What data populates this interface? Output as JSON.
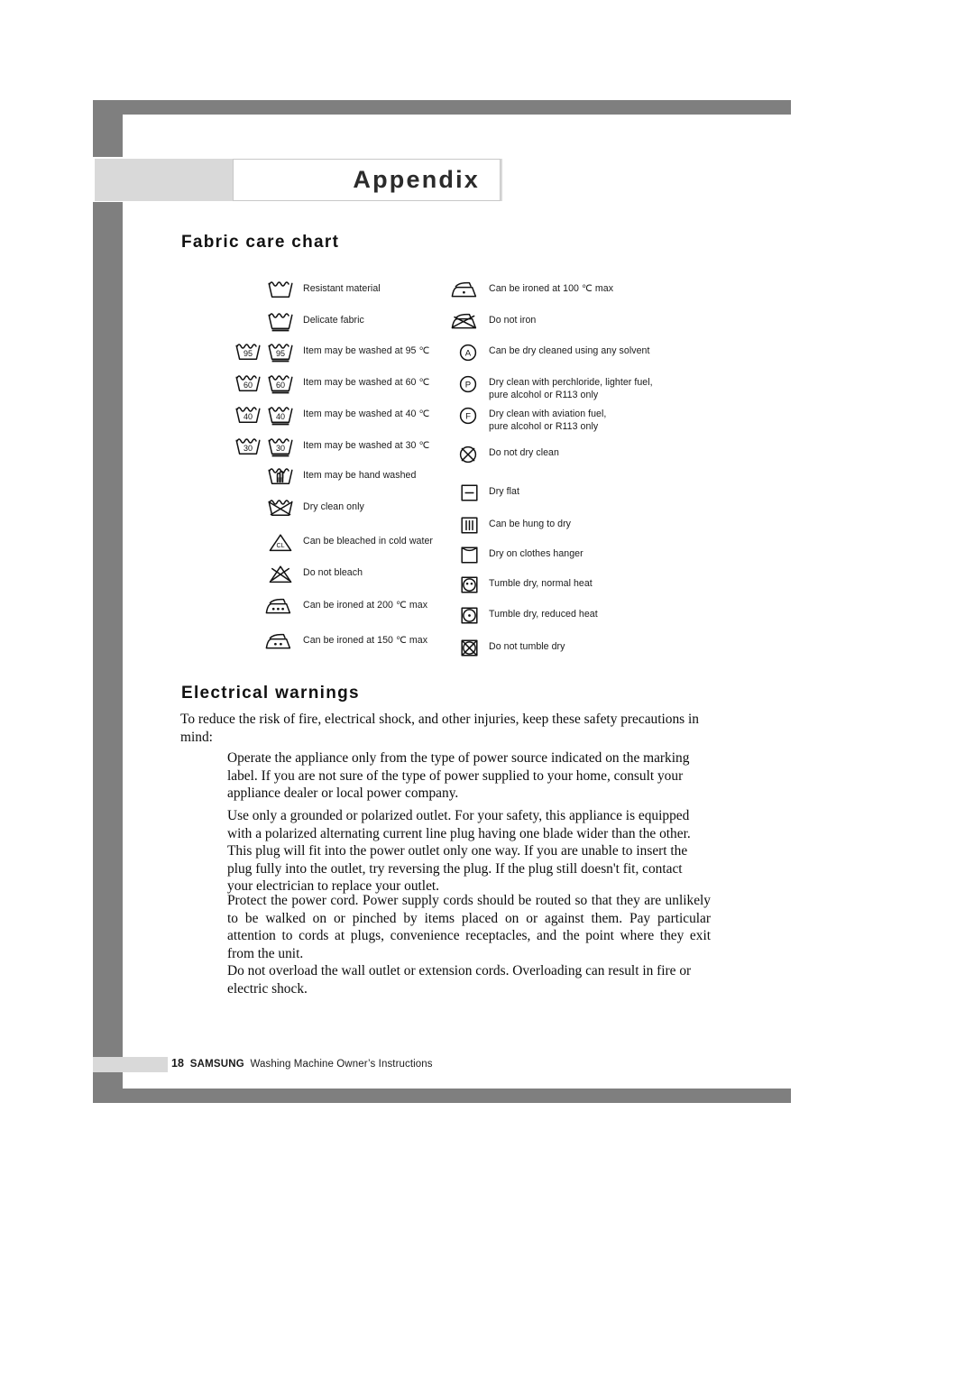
{
  "document": {
    "title": "Appendix"
  },
  "sections": {
    "fabric_care": {
      "heading": "Fabric care chart",
      "left_column": [
        {
          "icon": "wash-tub-resistant-icon",
          "label": "Resistant material"
        },
        {
          "icon": "wash-tub-delicate-icon",
          "label": "Delicate fabric"
        },
        {
          "icon": "wash-tub-95-icon",
          "label": "Item may be washed at 95 ℃"
        },
        {
          "icon": "wash-tub-60-icon",
          "label": "Item may be washed at 60 ℃"
        },
        {
          "icon": "wash-tub-40-icon",
          "label": "Item may be washed at 40 ℃"
        },
        {
          "icon": "wash-tub-30-icon",
          "label": "Item may be washed at 30 ℃"
        },
        {
          "icon": "hand-wash-icon",
          "label": "Item may be hand washed"
        },
        {
          "icon": "dry-clean-only-icon",
          "label": "Dry clean only"
        },
        {
          "icon": "bleach-cold-water-icon",
          "label": "Can be bleached in cold water"
        },
        {
          "icon": "do-not-bleach-icon",
          "label": "Do not bleach"
        },
        {
          "icon": "iron-200-icon",
          "label": "Can be ironed at 200 ℃ max"
        },
        {
          "icon": "iron-150-icon",
          "label": "Can be ironed at 150 ℃ max"
        }
      ],
      "right_column": [
        {
          "icon": "iron-100-icon",
          "label": "Can be ironed at 100 ℃  max"
        },
        {
          "icon": "do-not-iron-icon",
          "label": "Do not iron"
        },
        {
          "icon": "dry-clean-any-solvent-icon",
          "label": "Can be dry cleaned using any solvent"
        },
        {
          "icon": "dry-clean-perchloride-icon",
          "label": "Dry clean with perchloride, lighter fuel,\npure alcohol or R113 only"
        },
        {
          "icon": "dry-clean-aviation-fuel-icon",
          "label": "Dry clean with aviation fuel,\npure alcohol or R113 only"
        },
        {
          "icon": "do-not-dry-clean-icon",
          "label": "Do not dry clean"
        },
        {
          "icon": "dry-flat-icon",
          "label": "Dry flat"
        },
        {
          "icon": "hang-to-dry-icon",
          "label": "Can be hung to dry"
        },
        {
          "icon": "dry-on-hanger-icon",
          "label": "Dry on clothes hanger"
        },
        {
          "icon": "tumble-dry-normal-icon",
          "label": " Tumble dry, normal heat"
        },
        {
          "icon": "tumble-dry-reduced-icon",
          "label": "Tumble dry, reduced heat"
        },
        {
          "icon": "do-not-tumble-dry-icon",
          "label": "Do not tumble dry"
        }
      ]
    },
    "electrical_warnings": {
      "heading": "Electrical warnings",
      "intro": "To reduce the risk of fire, electrical shock, and other injuries, keep these safety precautions in mind:",
      "paragraphs": [
        "Operate the appliance only from the type of power source indicated on the marking label.  If you are not sure of the type of power supplied to your home, consult your appliance dealer or local power company.",
        "Use only a grounded or polarized outlet.  For your safety, this appliance is equipped with a polarized alternating current line plug having one blade wider than the other.  This plug will fit into the power outlet only one way.  If you are unable to insert the plug fully into the outlet, try reversing the plug.  If the plug still doesn't fit, contact your electrician to replace your outlet.",
        "Protect the power cord. Power supply cords should be routed so that they are unlikely to be walked on or pinched by items placed on or against them.  Pay particular attention to cords at plugs, convenience receptacles, and the point where they exit from the unit.",
        "Do not overload the wall outlet or extension cords.  Overloading can result in fire or electric shock."
      ]
    }
  },
  "footer": {
    "page_number": "18",
    "brand": "SAMSUNG",
    "manual_title": "Washing Machine Owner’s Instructions"
  },
  "colors": {
    "frame_gray": "#7f7f7f",
    "band_gray": "#d9d9d9",
    "text": "#1a1a1a"
  },
  "wash_temperatures": [
    "95",
    "60",
    "40",
    "30"
  ]
}
